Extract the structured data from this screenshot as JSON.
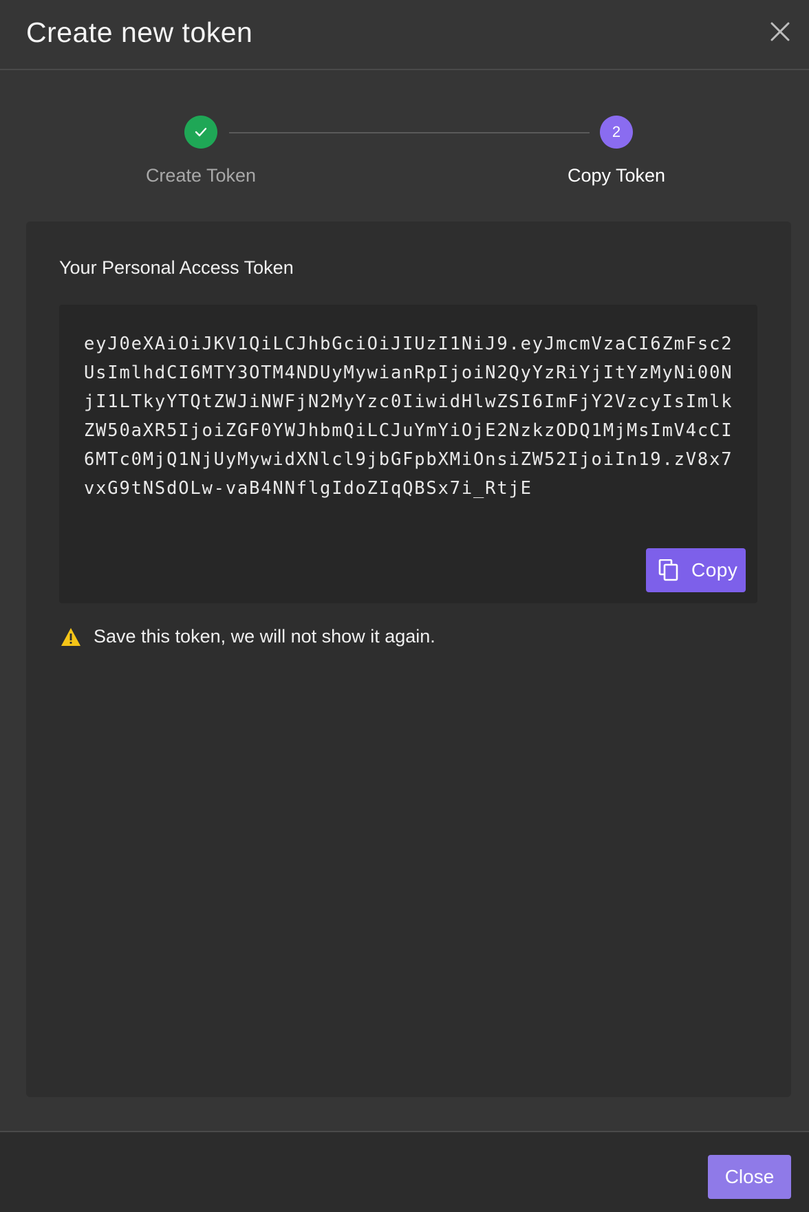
{
  "dialog": {
    "title": "Create new token",
    "close_icon": "close-icon"
  },
  "stepper": {
    "steps": [
      {
        "label": "Create Token",
        "status": "completed",
        "icon": "check-icon"
      },
      {
        "label": "Copy Token",
        "status": "active",
        "number": "2"
      }
    ]
  },
  "token_panel": {
    "label": "Your Personal Access Token",
    "token": "eyJ0eXAiOiJKV1QiLCJhbGciOiJIUzI1NiJ9.eyJmcmVzaCI6ZmFsc2UsImlhdCI6MTY3OTM4NDUyMywianRpIjoiN2QyYzRiYjItYzMyNi00NjI1LTkyYTQtZWJiNWFjN2MyYzc0IiwidHlwZSI6ImFjY2VzcyIsImlkZW50aXR5IjoiZGF0YWJhbmQiLCJuYmYiOjE2NzkzODQ1MjMsImV4cCI6MTc0MjQ1NjUyMywidXNlcl9jbGFpbXMiOnsiZW52IjoiIn19.zV8x7vxG9tNSdOLw-vaB4NNflgIdoZIqQBSx7i_RtjE",
    "copy_label": "Copy",
    "copy_icon": "copy-icon"
  },
  "warning": {
    "icon": "warning-icon",
    "text": "Save this token, we will not show it again."
  },
  "footer": {
    "close_label": "Close"
  },
  "colors": {
    "background": "#363636",
    "panel": "#2e2e2e",
    "accent": "#7d60ea",
    "success": "#1fa756",
    "warning": "#f5c518"
  }
}
